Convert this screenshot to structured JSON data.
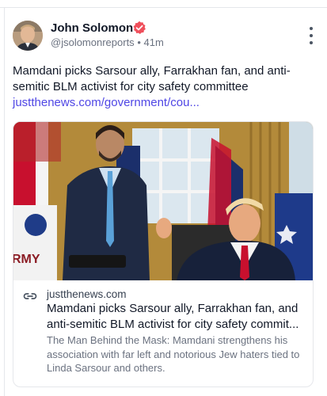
{
  "author": {
    "name": "John Solomon",
    "handle": "@jsolomonreports",
    "separator": "•",
    "time": "41m",
    "verified_color": "#ef4f5b",
    "avatar_icon": "author-avatar"
  },
  "menu": {
    "icon": "more-vertical-icon"
  },
  "post": {
    "text": "Mamdani picks Sarsour ally, Farrakhan fan, and anti-semitic BLM activist for city safety committee",
    "link": "justthenews.com/government/cou...",
    "link_color": "#4f46e5"
  },
  "card": {
    "image_description_icon": "article-photo",
    "domain": "justthenews.com",
    "title_line1": "Mamdani picks Sarsour ally, Farrakhan fan, and",
    "title_line2": "anti-semitic BLM activist for city safety commit...",
    "description": "The Man Behind the Mask: Mamdani strengthens his association with far left and notorious Jew haters tied to Linda Sarsour and others.",
    "link_icon": "link-icon",
    "flag_text": "RMY"
  }
}
